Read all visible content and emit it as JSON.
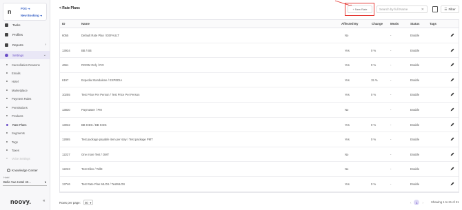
{
  "sidebar": {
    "brand_initial": "n",
    "pos_label": "POS",
    "new_booking_label": "New Booking",
    "items": [
      {
        "label": "Tasks",
        "icon": "tasks-icon"
      },
      {
        "label": "Profiles",
        "icon": "profiles-icon"
      },
      {
        "label": "Reports",
        "icon": "reports-icon"
      },
      {
        "label": "Settings",
        "icon": "settings-icon"
      }
    ],
    "sub_items": [
      "Cancellation Reasons",
      "Emails",
      "Hotel",
      "Marketplace",
      "Payment Rules",
      "Permissions",
      "Products",
      "Rate Plans",
      "Segments",
      "Tags",
      "Taxes",
      "Voice Settings"
    ],
    "knowledge_center": "Knowledge Center",
    "hotel_label": "Hotel",
    "hotel_value": "Belle Vue Hotel 42...",
    "footer_logo": "noovy."
  },
  "header": {
    "back_label": "< Rate Plans",
    "new_rate_label": "+ New Rate",
    "search_placeholder": "Search by full Name",
    "filter_label": "Filter"
  },
  "table": {
    "columns": [
      "ID",
      "Name",
      "Affected By",
      "Change",
      "Meals",
      "Status",
      "Tags"
    ],
    "rows": [
      {
        "id": "6055",
        "name": "Default Rate Plan / DEFAULT",
        "affected": "No",
        "change": "",
        "meals": "-",
        "status": "Enable"
      },
      {
        "id": "13934",
        "name": "BB / BB",
        "affected": "Yes",
        "change": "0 %",
        "meals": "-",
        "status": "Enable"
      },
      {
        "id": "4661",
        "name": "ROOM Only / RO",
        "affected": "Yes",
        "change": "0 %",
        "meals": "-",
        "status": "Enable"
      },
      {
        "id": "6197",
        "name": "Expedia Standalone / EXPEDIA",
        "affected": "Yes",
        "change": "15 %",
        "meals": "-",
        "status": "Enable"
      },
      {
        "id": "10255",
        "name": "Test Price Per Person / Test Price Per Person",
        "affected": "Yes",
        "change": "0 %",
        "meals": "-",
        "status": "Enable"
      },
      {
        "id": "13830",
        "name": "Paymaster / PM",
        "affected": "No",
        "change": "",
        "meals": "-",
        "status": "Enable"
      },
      {
        "id": "13032",
        "name": "BB KIDS / BB KIDS",
        "affected": "Yes",
        "change": "0 %",
        "meals": "-",
        "status": "Enable"
      },
      {
        "id": "12865",
        "name": "Test package payable item per stay / Test package PMT",
        "affected": "Yes",
        "change": "0 %",
        "meals": "-",
        "status": "Enable"
      },
      {
        "id": "12227",
        "name": "One more Test / OMT",
        "affected": "No",
        "change": "",
        "meals": "-",
        "status": "Enable"
      },
      {
        "id": "12223",
        "name": "Test Ellen / TellE",
        "affected": "No",
        "change": "",
        "meals": "-",
        "status": "Enable"
      },
      {
        "id": "13746",
        "name": "Test Rate Plan MLOS / TestMLOS",
        "affected": "Yes",
        "change": "0 %",
        "meals": "-",
        "status": "Enable"
      }
    ]
  },
  "footer": {
    "rows_per_page_label": "Rows per page:",
    "rows_per_page_value": "50",
    "current_page": "1",
    "showing": "Showing 1 to 21 of 21"
  },
  "colors": {
    "accent": "#6b4ec7",
    "highlight": "#e53935"
  }
}
